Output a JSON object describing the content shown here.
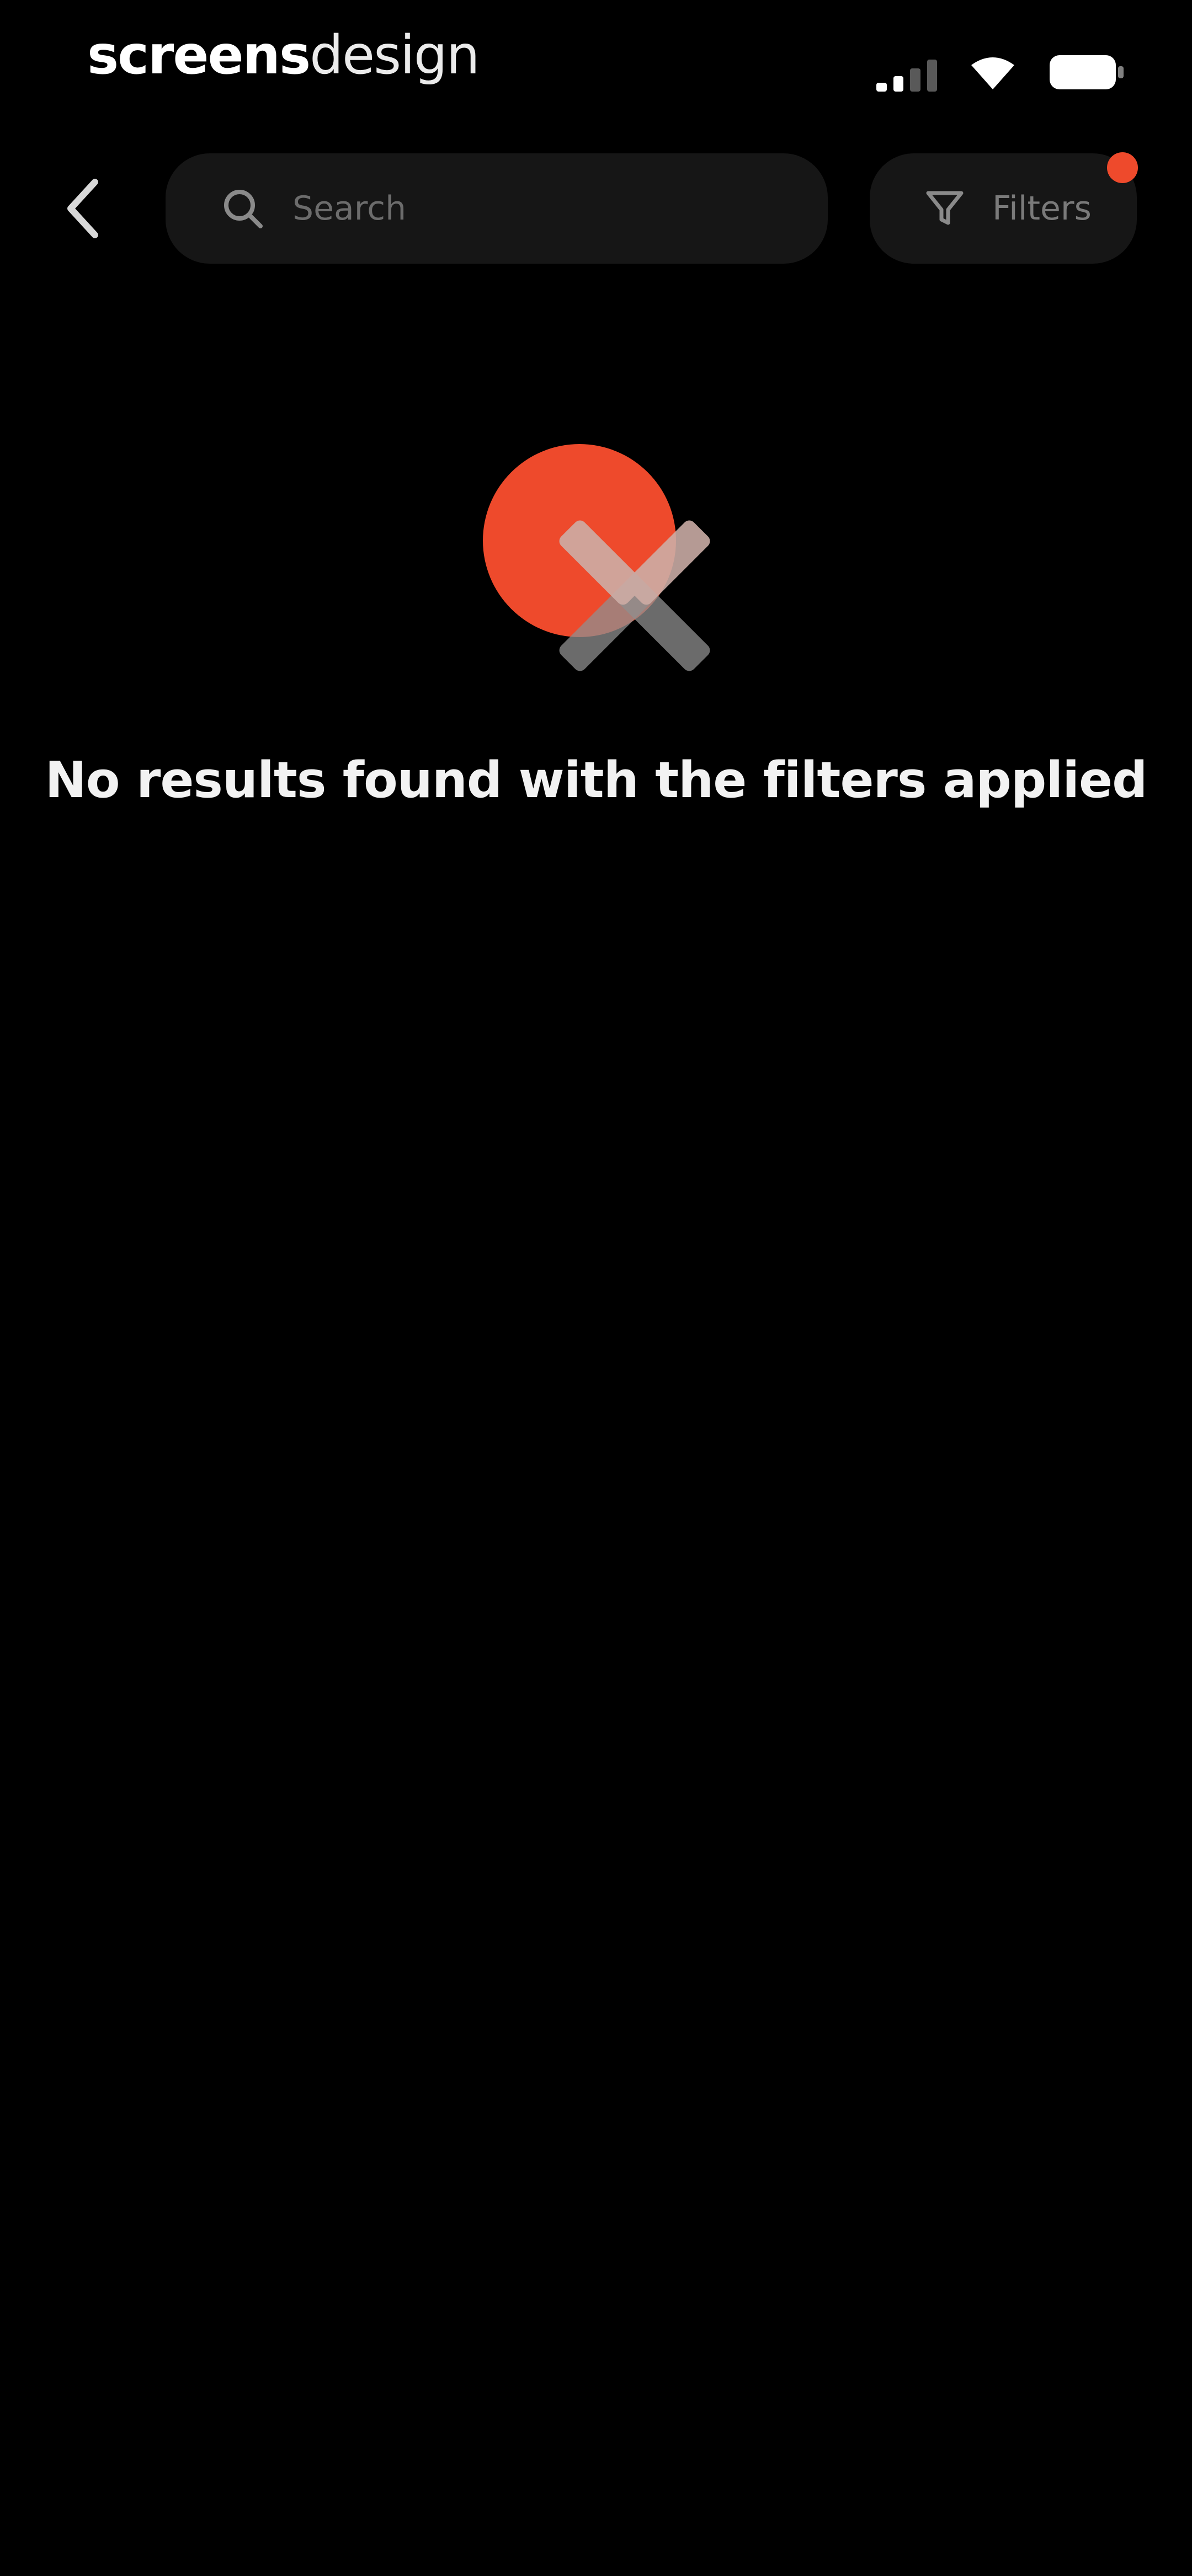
{
  "status_bar": {
    "brand_bold": "screens",
    "brand_light": "design",
    "signal_icon": "signal-icon",
    "wifi_icon": "wifi-icon",
    "battery_icon": "battery-icon"
  },
  "header": {
    "back_icon": "chevron-left-icon",
    "search": {
      "placeholder": "Search",
      "value": "",
      "icon": "search-icon"
    },
    "filters": {
      "label": "Filters",
      "icon": "funnel-icon",
      "badge_color": "#ee4a2c"
    }
  },
  "empty_state": {
    "icon": "no-results-icon",
    "message": "No results found with the filters applied"
  },
  "colors": {
    "background": "#000000",
    "surface": "#161616",
    "accent": "#ee4a2c",
    "text_primary": "#f2f2f2",
    "text_muted": "#7a7a7a"
  }
}
